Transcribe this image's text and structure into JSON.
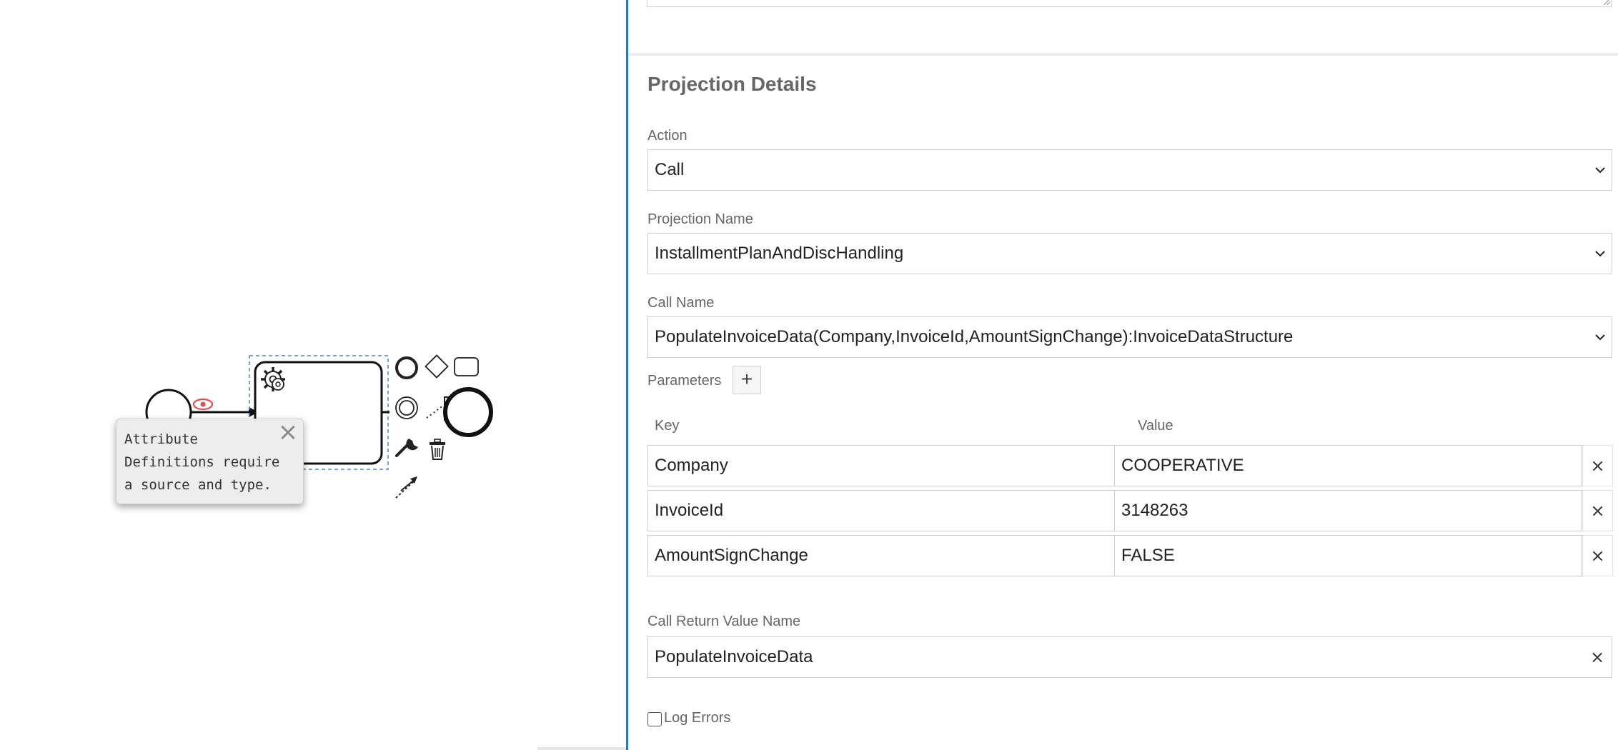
{
  "canvas": {
    "tooltip_text": "Attribute\nDefinitions require\na source and type.",
    "tooltip_close": "×"
  },
  "panel": {
    "section_title": "Projection Details",
    "action": {
      "label": "Action",
      "value": "Call"
    },
    "projection_name": {
      "label": "Projection Name",
      "value": "InstallmentPlanAndDiscHandling"
    },
    "call_name": {
      "label": "Call Name",
      "value": "PopulateInvoiceData(Company,InvoiceId,AmountSignChange):InvoiceDataStructure"
    },
    "parameters": {
      "label": "Parameters",
      "add_label": "+",
      "key_header": "Key",
      "value_header": "Value",
      "remove_label": "×",
      "rows": [
        {
          "key": "Company",
          "value": "COOPERATIVE"
        },
        {
          "key": "InvoiceId",
          "value": "3148263"
        },
        {
          "key": "AmountSignChange",
          "value": "FALSE"
        }
      ]
    },
    "return_value": {
      "label": "Call Return Value Name",
      "value": "PopulateInvoiceData",
      "clear_label": "×"
    },
    "log_errors": {
      "label": "Log Errors",
      "checked": false
    }
  },
  "colors": {
    "divider": "#2a7bb5",
    "selection": "#4a86c5",
    "warning": "#e05050"
  }
}
